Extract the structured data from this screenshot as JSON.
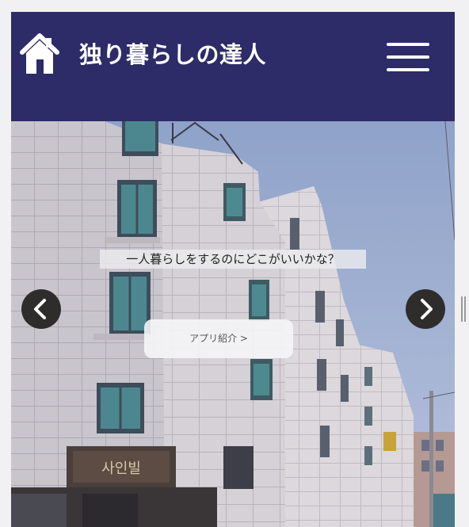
{
  "header": {
    "title": "独り暮らしの達人",
    "home_icon": "home-icon",
    "menu_icon": "hamburger-menu-icon",
    "background_color": "#2d2c68"
  },
  "carousel": {
    "caption": "一人暮らしをするのにどこがいいかな？",
    "cta_label": "アプリ紹介 >",
    "prev_icon": "chevron-left-icon",
    "next_icon": "chevron-right-icon",
    "image": "apartment-building-photo",
    "sign_text": "사인빌"
  }
}
